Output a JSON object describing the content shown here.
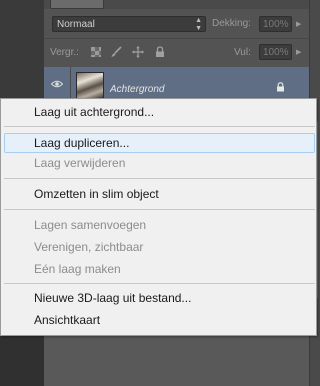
{
  "layers_panel": {
    "blend_mode": "Normaal",
    "opacity_label": "Dekking:",
    "opacity_value": "100%",
    "lock_label": "Vergr.:",
    "fill_label": "Vul:",
    "fill_value": "100%",
    "layer": {
      "name": "Achtergrond"
    }
  },
  "context_menu": {
    "items": [
      {
        "label": "Laag uit achtergrond...",
        "enabled": true
      },
      {
        "label": "Laag dupliceren...",
        "enabled": true,
        "highlighted": true
      },
      {
        "label": "Laag verwijderen",
        "enabled": false
      },
      {
        "label": "Omzetten in slim object",
        "enabled": true
      },
      {
        "label": "Lagen samenvoegen",
        "enabled": false
      },
      {
        "label": "Verenigen, zichtbaar",
        "enabled": false
      },
      {
        "label": "Eén laag maken",
        "enabled": false
      },
      {
        "label": "Nieuwe 3D-laag uit bestand...",
        "enabled": true
      },
      {
        "label": "Ansichtkaart",
        "enabled": true
      }
    ]
  },
  "colors": {
    "panel_bg": "#535353",
    "selected_layer": "#5f6e85",
    "menu_bg": "#f0f0f0",
    "menu_highlight": "#e5f0fb",
    "disabled_text": "#8c8c8c"
  }
}
